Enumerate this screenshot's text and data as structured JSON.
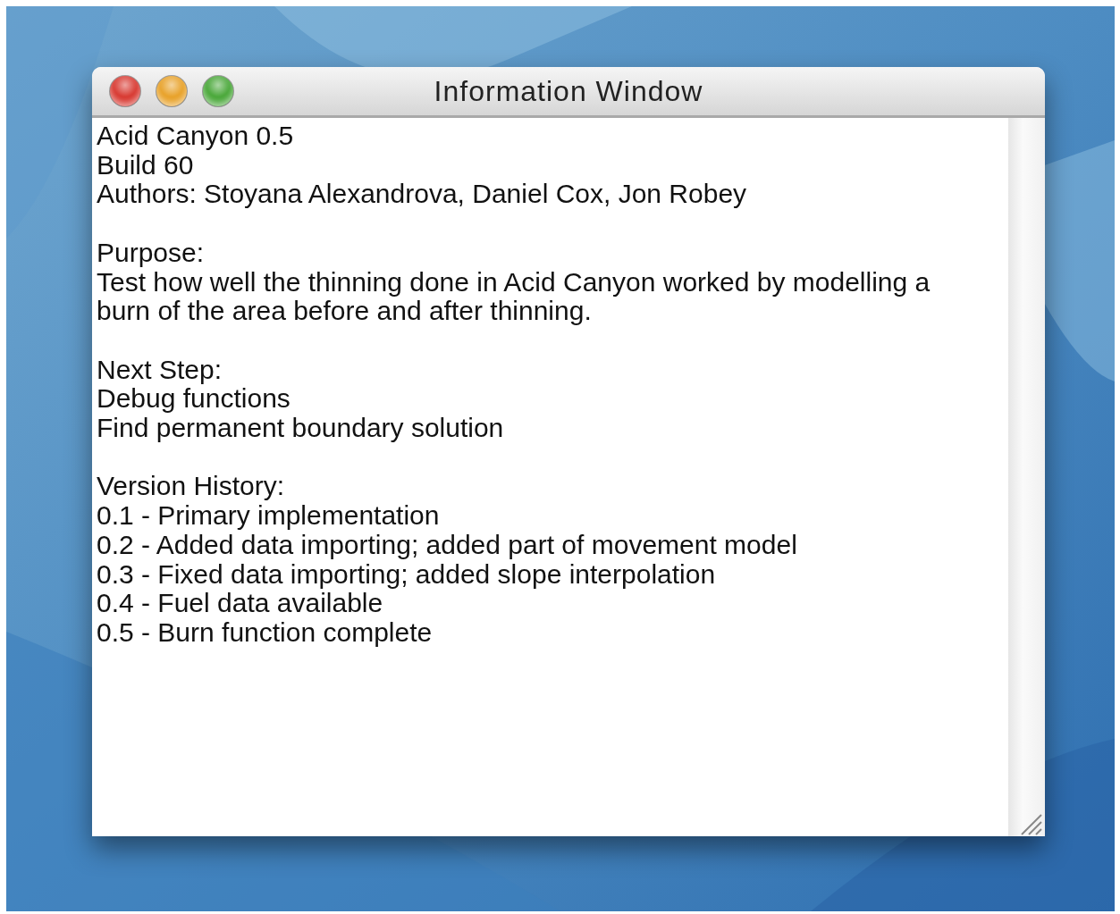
{
  "window": {
    "title": "Information Window",
    "buttons": [
      {
        "color": "#d83a32"
      },
      {
        "color": "#e8a22a"
      },
      {
        "color": "#4aa83a"
      }
    ]
  },
  "content": {
    "sections": [
      {
        "lines": [
          "Acid Canyon 0.5",
          "Build 60",
          "Authors: Stoyana Alexandrova, Daniel Cox, Jon Robey"
        ]
      },
      {
        "lines": [
          "Purpose:",
          "Test how well the thinning done in Acid Canyon worked by modelling a",
          "burn of the area before and after thinning."
        ]
      },
      {
        "lines": [
          "Next Step:",
          "Debug functions",
          "Find permanent boundary solution"
        ]
      },
      {
        "lines": [
          "Version History:",
          "0.1 - Primary implementation",
          "0.2 - Added data importing; added part of movement model",
          "0.3 - Fixed data importing; added slope interpolation",
          "0.4 - Fuel data available",
          "0.5 - Burn function complete"
        ]
      }
    ]
  }
}
